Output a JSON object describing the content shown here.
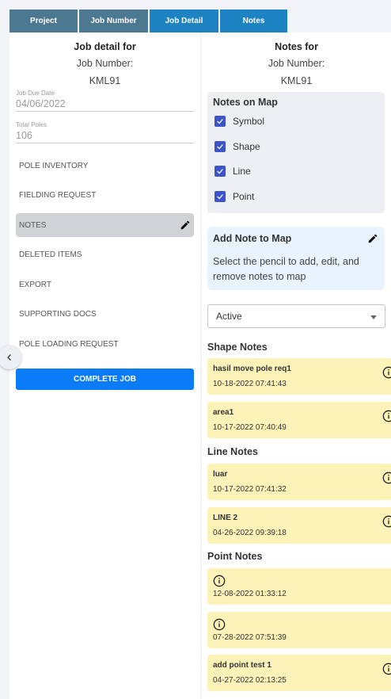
{
  "tabs": [
    "Project",
    "Job Number",
    "Job Detail",
    "Notes"
  ],
  "left": {
    "title": "Job detail for",
    "job_number_label": "Job Number:",
    "job_number": "KML91",
    "due_date_label": "Job Due Date",
    "due_date": "04/06/2022",
    "total_poles_label": "Total Poles",
    "total_poles": "106",
    "menu": [
      "POLE INVENTORY",
      "FIELDING REQUEST",
      "NOTES",
      "DELETED ITEMS",
      "EXPORT",
      "SUPPORTING DOCS",
      "POLE LOADING REQUEST"
    ],
    "active_menu": "NOTES",
    "complete_button": "COMPLETE JOB"
  },
  "right": {
    "title": "Notes for",
    "job_number_label": "Job Number:",
    "job_number": "KML91",
    "notes_on_map": {
      "title": "Notes on Map",
      "options": [
        {
          "label": "Symbol",
          "checked": true
        },
        {
          "label": "Shape",
          "checked": true
        },
        {
          "label": "Line",
          "checked": true
        },
        {
          "label": "Point",
          "checked": true
        }
      ]
    },
    "add_note": {
      "title": "Add Note to Map",
      "description": "Select the pencil to add, edit, and remove notes to map"
    },
    "filter": {
      "selected": "Active"
    },
    "shape_notes": {
      "title": "Shape Notes",
      "items": [
        {
          "title": "hasil move pole req1",
          "date": "10-18-2022 07:41:43"
        },
        {
          "title": "area1",
          "date": "10-17-2022 07:40:49"
        }
      ]
    },
    "line_notes": {
      "title": "Line Notes",
      "items": [
        {
          "title": "luar",
          "date": "10-17-2022 07:41:32"
        },
        {
          "title": "LINE 2",
          "date": "04-26-2022 09:39:18"
        }
      ]
    },
    "point_notes": {
      "title": "Point Notes",
      "items": [
        {
          "title": "",
          "date": "12-08-2022 01:33:12"
        },
        {
          "title": "",
          "date": "07-28-2022 07:51:39"
        },
        {
          "title": "add point test 1",
          "date": "04-27-2022 02:13:25"
        }
      ]
    }
  },
  "colors": {
    "tab_dark": "#4d7891",
    "tab_light": "#1d83c3",
    "primary_button": "#0a7cf8",
    "checkbox": "#3b55c8",
    "note_card": "#fdf2b8",
    "add_note_box": "#e8f3fd"
  }
}
